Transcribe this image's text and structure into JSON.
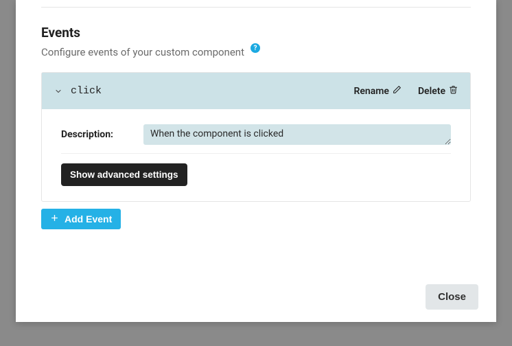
{
  "section": {
    "title": "Events",
    "subtitle": "Configure events of your custom component",
    "help_symbol": "?"
  },
  "events": [
    {
      "name": "click",
      "rename_label": "Rename",
      "delete_label": "Delete",
      "description_label": "Description:",
      "description_value": "When the component is clicked",
      "advanced_label": "Show advanced settings"
    }
  ],
  "buttons": {
    "add_event": "Add Event",
    "close": "Close"
  },
  "colors": {
    "accent": "#25b1e6",
    "panel_header": "#cce2e7",
    "field_bg": "#d2e4e8",
    "dark_btn": "#222222",
    "close_bg": "#e2e6e8"
  }
}
